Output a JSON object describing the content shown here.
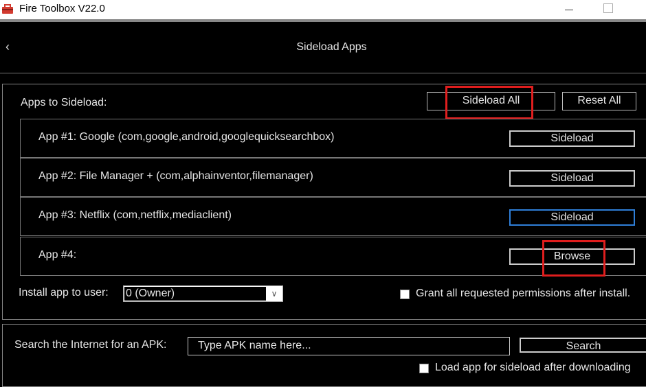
{
  "window": {
    "title": "Fire Toolbox V22.0"
  },
  "header": {
    "title": "Sideload Apps"
  },
  "apps": {
    "label": "Apps to Sideload:",
    "sideload_all_label": "Sideload All",
    "reset_all_label": "Reset All",
    "rows": [
      {
        "label": "App #1: Google (com,google,android,googlequicksearchbox)",
        "button": "Sideload"
      },
      {
        "label": "App #2: File Manager + (com,alphainventor,filemanager)",
        "button": "Sideload"
      },
      {
        "label": "App #3: Netflix (com,netflix,mediaclient)",
        "button": "Sideload"
      },
      {
        "label": "App #4:",
        "button": "Browse"
      }
    ]
  },
  "install": {
    "label": "Install app to user:",
    "selected": "0 (Owner)",
    "grant_label": "Grant all requested permissions after install."
  },
  "search": {
    "label": "Search the Internet for an APK:",
    "input_value": "Type APK name here...",
    "button": "Search",
    "load_label": "Load app for sideload after downloading"
  },
  "colors": {
    "background": "#000000",
    "annotation": "#e01e1e",
    "focus": "#2f7fd8"
  }
}
